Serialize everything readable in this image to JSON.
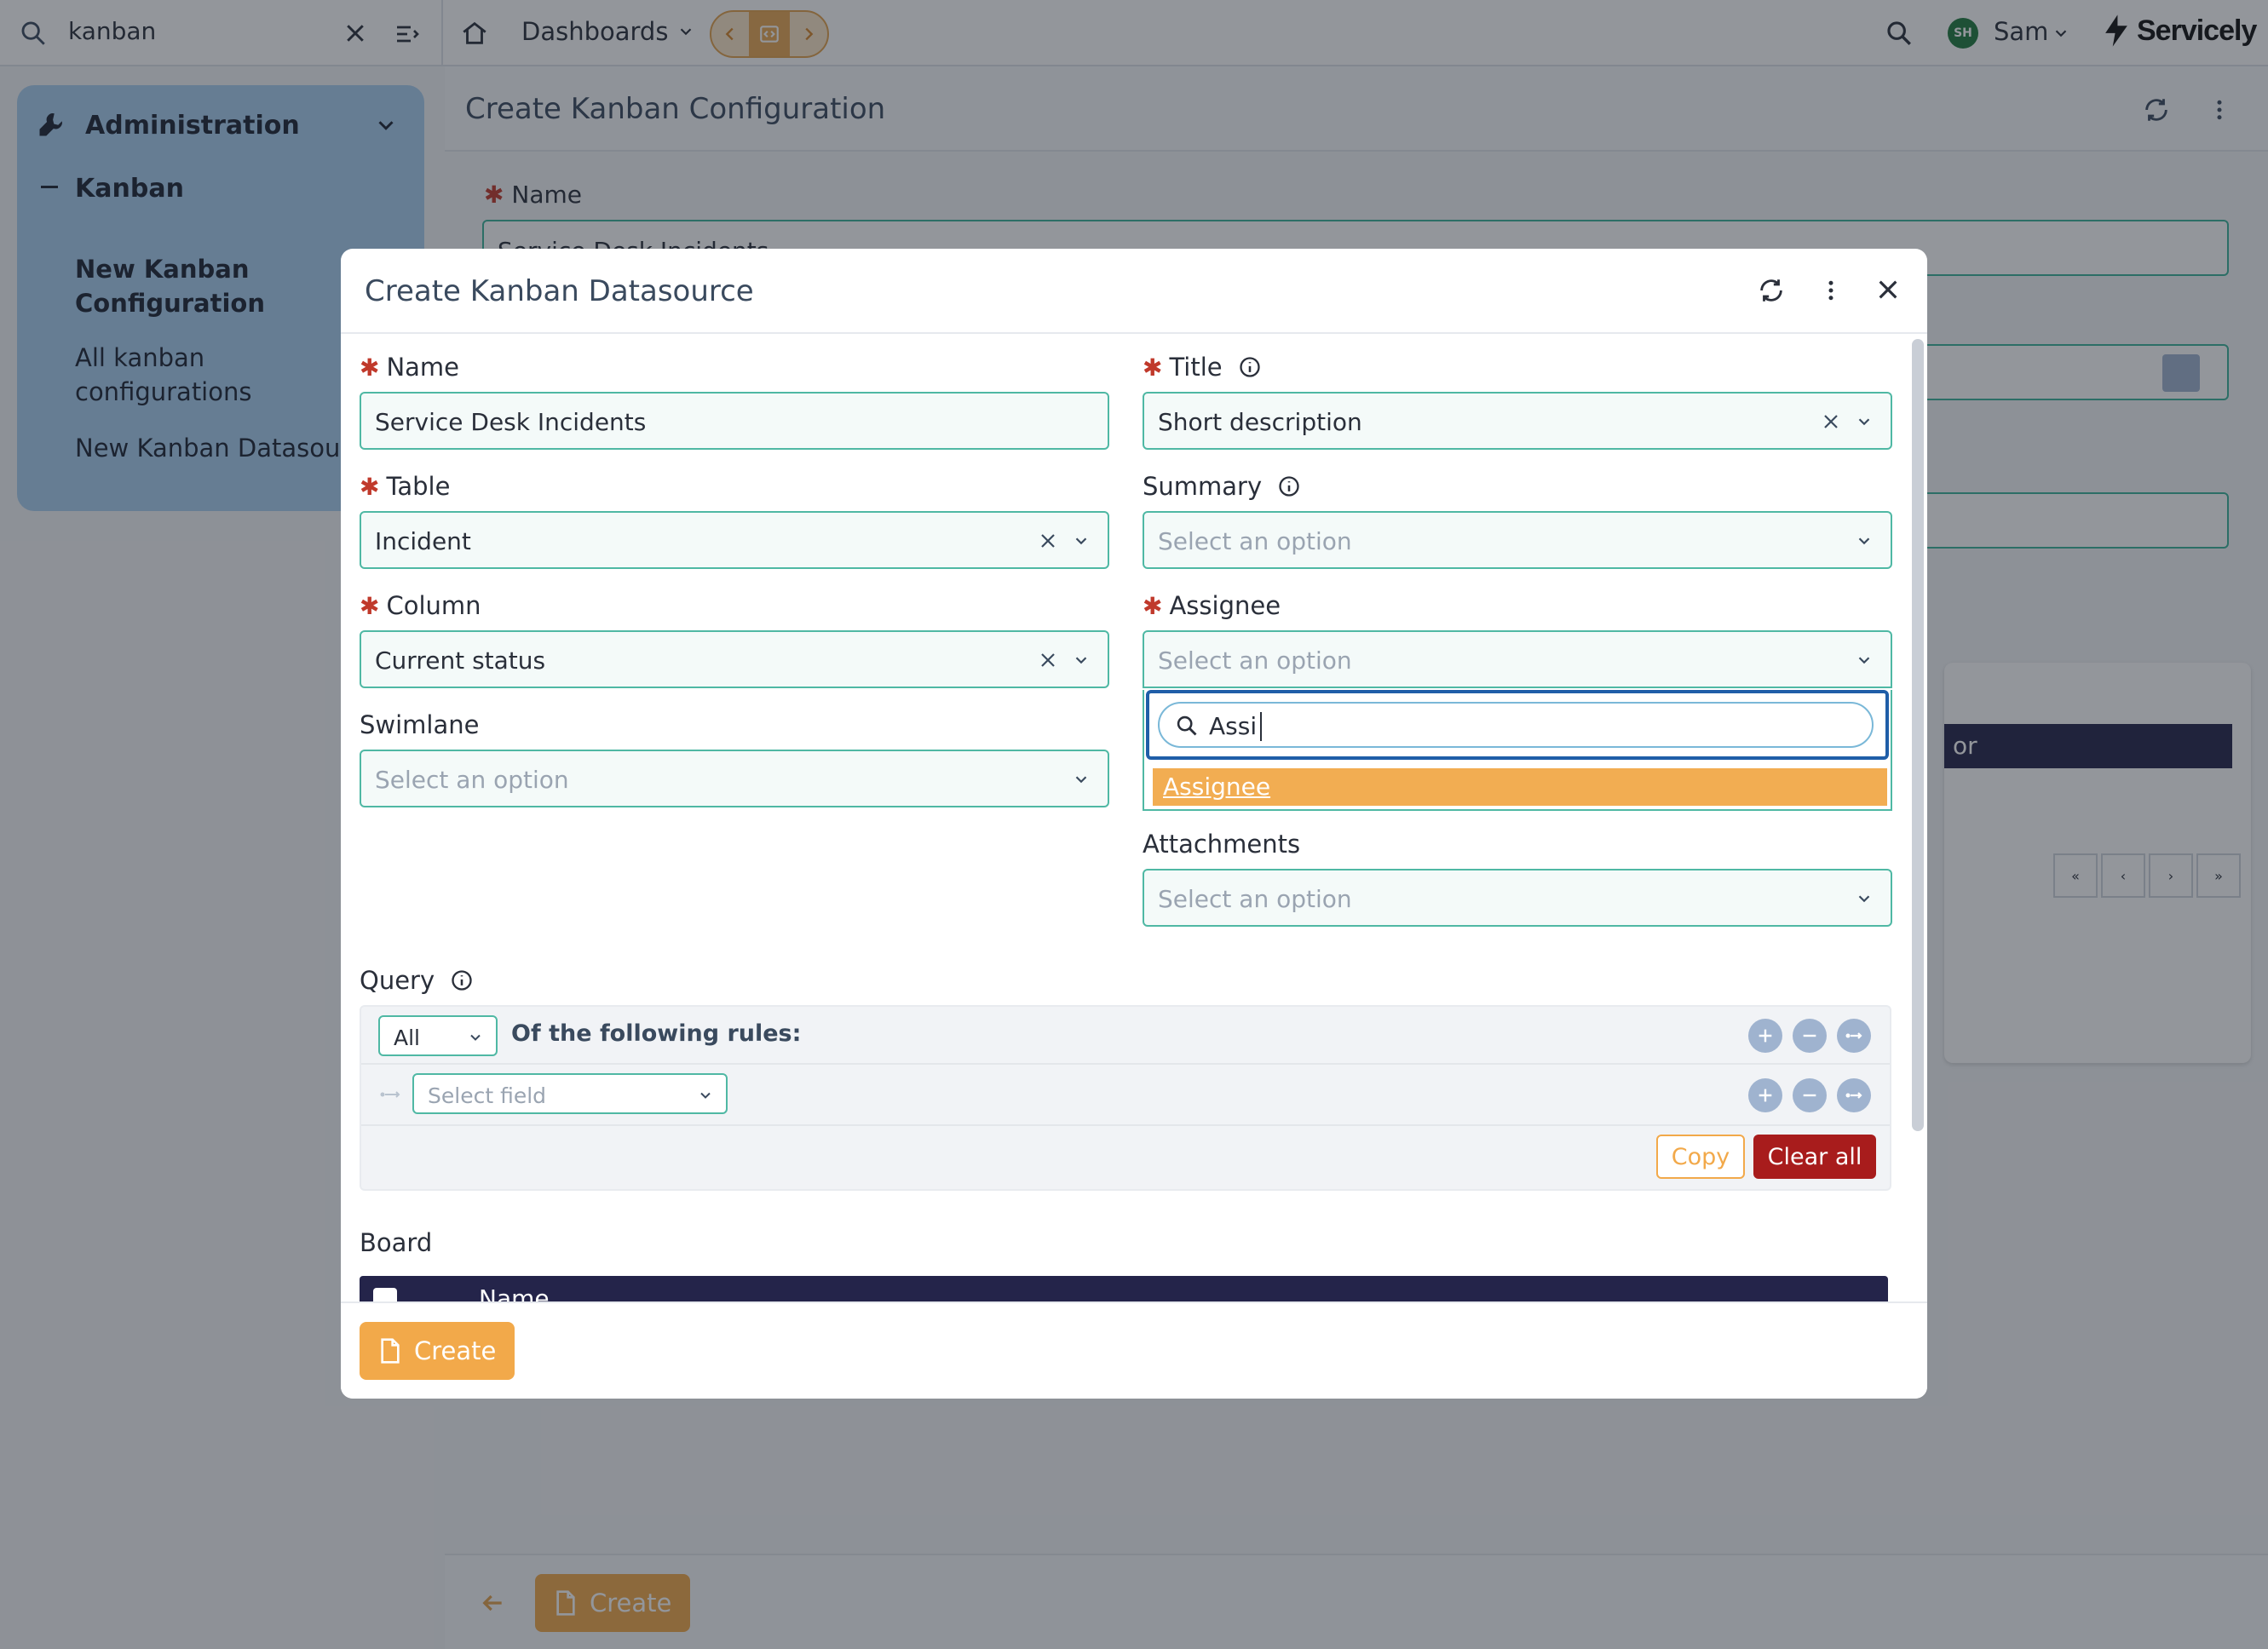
{
  "topbar": {
    "search_value": "kanban",
    "dashboards_label": "Dashboards",
    "user_initials": "SH",
    "user_name": "Sam",
    "brand_name": "Servicely"
  },
  "sidebar": {
    "section_title": "Administration",
    "subsection_title": "Kanban",
    "items": [
      {
        "label": "New Kanban Configuration"
      },
      {
        "label": "All kanban configurations"
      },
      {
        "label": "New Kanban Datasource"
      }
    ]
  },
  "page": {
    "title": "Create Kanban Configuration",
    "name_label": "Name",
    "name_value": "Service Desk Incidents",
    "table_header_fragment": "or",
    "create_label": "Create"
  },
  "modal": {
    "title": "Create Kanban Datasource",
    "name_label": "Name",
    "name_value": "Service Desk Incidents",
    "title_label": "Title",
    "title_value": "Short description",
    "table_label": "Table",
    "table_value": "Incident",
    "summary_label": "Summary",
    "summary_placeholder": "Select an option",
    "column_label": "Column",
    "column_value": "Current status",
    "assignee_label": "Assignee",
    "assignee_placeholder": "Select an option",
    "assignee_search": "Assi",
    "assignee_option": "Assignee",
    "swimlane_label": "Swimlane",
    "swimlane_placeholder": "Select an option",
    "attachments_label": "Attachments",
    "attachments_placeholder": "Select an option",
    "query_label": "Query",
    "query_match": "All",
    "query_rules_text": "Of the following rules:",
    "query_field_placeholder": "Select field",
    "copy_label": "Copy",
    "clear_label": "Clear all",
    "board_label": "Board",
    "board_column": "Name",
    "create_label": "Create"
  },
  "colors": {
    "accent": "#f2a94a",
    "field_border": "#4fb8a4",
    "danger": "#a81c1c",
    "sidebar_bg": "#a9cff0",
    "board_header": "#24244a"
  }
}
